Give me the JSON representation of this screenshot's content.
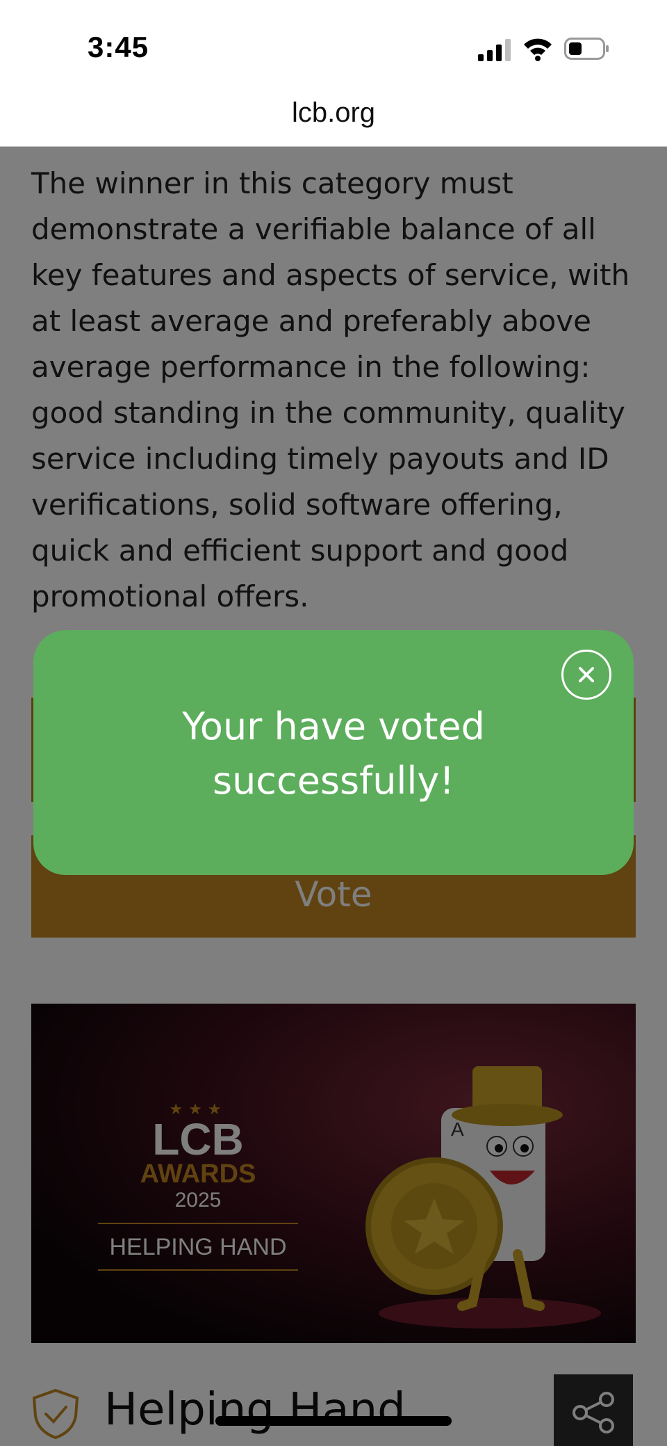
{
  "status_bar": {
    "time": "3:45"
  },
  "browser": {
    "url": "lcb.org"
  },
  "page": {
    "description": "The winner in this category must demonstrate a verifiable balance of all key features and aspects of service, with at least average and preferably above average performance in the following: good standing in the community, quality service including timely payouts and ID verifications, solid software offering, quick and efficient support and good promotional offers.",
    "vote_button": "Vote",
    "banner": {
      "lcb": "LCB",
      "awards": "AWARDS",
      "year": "2025",
      "category": "HELPING HAND",
      "suit_letter": "A"
    },
    "category_title": "Helping Hand"
  },
  "toast": {
    "message": "Your have voted successfully!"
  },
  "colors": {
    "accent_gold": "#c18721",
    "toast_green": "#5cad5c",
    "overlay": "rgba(0,0,0,0.5)"
  },
  "icons": [
    "signal-icon",
    "wifi-icon",
    "battery-icon",
    "close-icon",
    "shield-check-icon",
    "share-icon"
  ]
}
